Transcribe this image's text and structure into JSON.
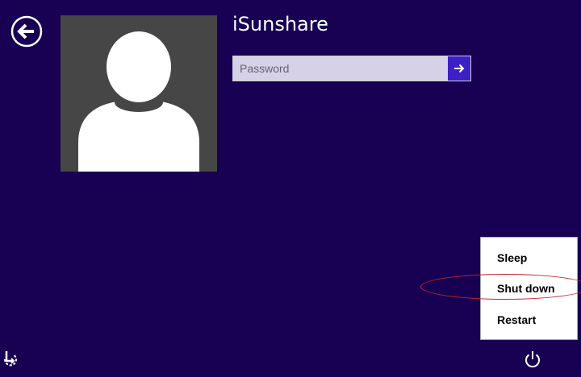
{
  "user": {
    "name": "iSunshare"
  },
  "password": {
    "placeholder": "Password",
    "value": ""
  },
  "power_menu": {
    "items": [
      {
        "label": "Sleep"
      },
      {
        "label": "Shut down"
      },
      {
        "label": "Restart"
      }
    ]
  },
  "icons": {
    "back": "back-arrow-icon",
    "submit": "arrow-right-icon",
    "ease_of_access": "ease-of-access-icon",
    "power": "power-icon"
  },
  "colors": {
    "background": "#180052",
    "submit_button": "#3d1fc4",
    "highlight": "#c0272d",
    "avatar_background": "#464646"
  }
}
